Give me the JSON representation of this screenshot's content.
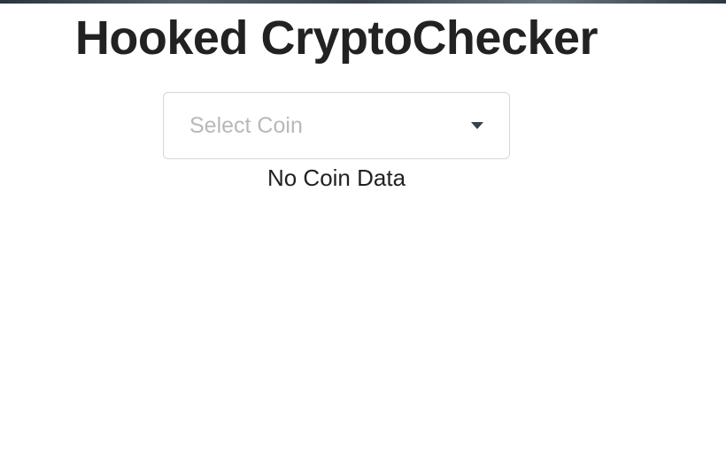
{
  "header": {
    "title": "Hooked CryptoChecker"
  },
  "coin_select": {
    "placeholder": "Select Coin",
    "icon": "caret-down-icon"
  },
  "status": {
    "text": "No Coin Data"
  },
  "colors": {
    "title": "#222222",
    "placeholder": "#b8b8b8",
    "border": "#d6d6d6",
    "caret": "#36424f",
    "top_strip": "#3a434e"
  }
}
